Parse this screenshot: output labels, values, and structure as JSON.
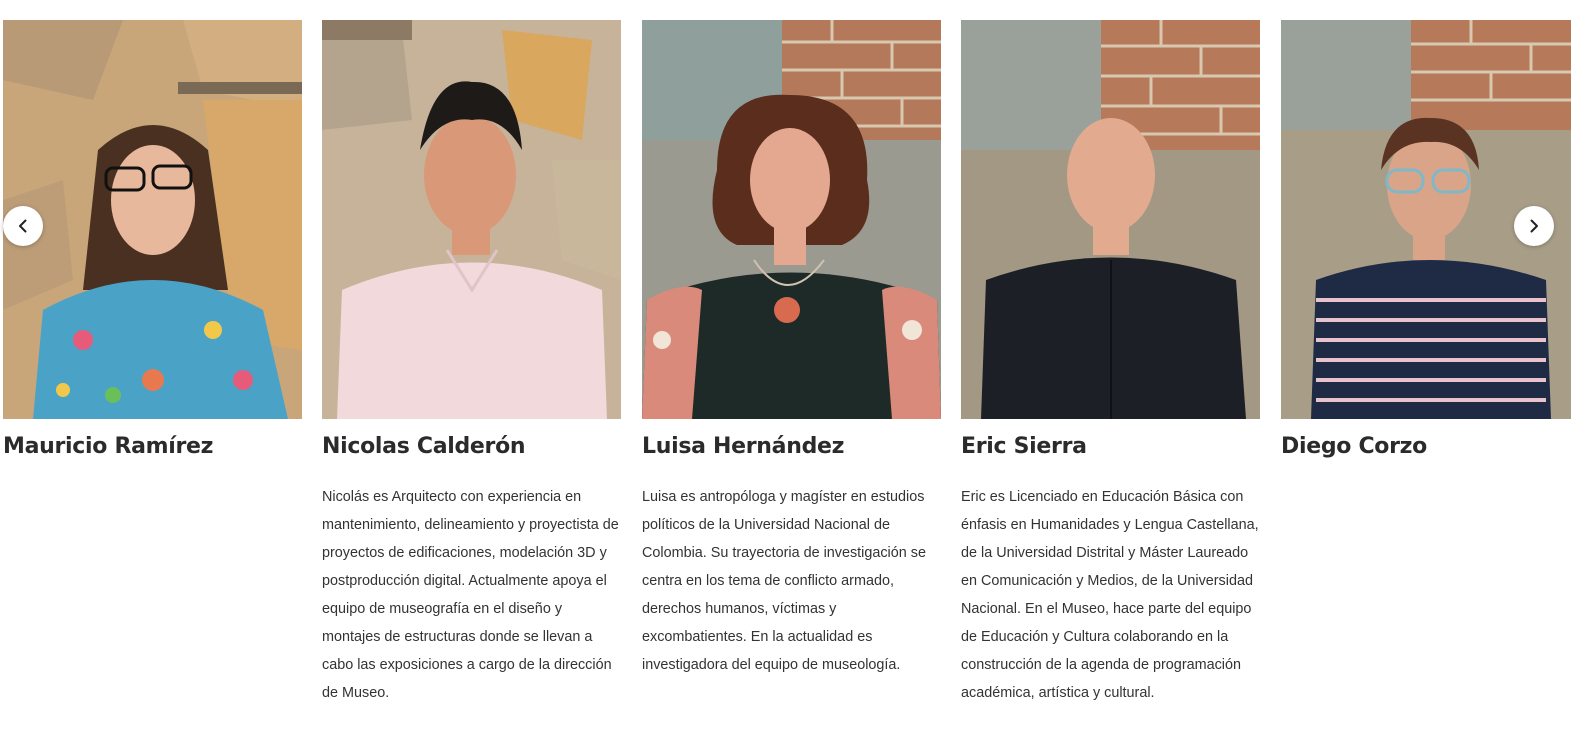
{
  "team": {
    "members": [
      {
        "name": "Mauricio Ramírez",
        "bio": "",
        "photo": {
          "bg": "#c9a57a",
          "shirt": "#4aa3c7",
          "skin": "#e8b89c",
          "hair": "#4a3020",
          "photo_label": "portrait-mauricio"
        }
      },
      {
        "name": "Nicolas Calderón",
        "bio": "Nicolás es Arquitecto con experiencia en mantenimiento, delineamiento y proyectista de proyectos de edificaciones, modelación 3D y postproducción digital. Actualmente apoya el equipo de museografía en el diseño y montajes de estructuras donde se llevan a cabo las exposiciones a cargo de la dirección de Museo.",
        "photo": {
          "bg": "#c7b39a",
          "shirt": "#f2d9dc",
          "skin": "#d99878",
          "hair": "#1e1a18",
          "photo_label": "portrait-nicolas"
        }
      },
      {
        "name": "Luisa Hernández",
        "bio": "Luisa es antropóloga y magíster en estudios políticos de la Universidad Nacional de Colombia. Su trayectoria de investigación se centra en los tema de conflicto armado, derechos humanos, víctimas y excombatientes. En la actualidad es investigadora del equipo de museología.",
        "photo": {
          "bg": "#9a9c96",
          "shirt": "#1e2a27",
          "skin": "#e3a88f",
          "hair": "#5a2d1c",
          "photo_label": "portrait-luisa"
        }
      },
      {
        "name": "Eric Sierra",
        "bio": "Eric es Licenciado en Educación Básica con énfasis en Humanidades y Lengua Castellana, de la Universidad Distrital y Máster Laureado en Comunicación y Medios, de la Universidad Nacional. En el Museo, hace parte del equipo de Educación y Cultura colaborando en la construcción de la agenda de programación académica, artística y cultural.",
        "photo": {
          "bg": "#a49c8c",
          "shirt": "#1c1f26",
          "skin": "#e2ab8f",
          "hair": "#c48a6c",
          "photo_label": "portrait-eric"
        }
      },
      {
        "name": "Diego Corzo",
        "bio": "",
        "photo": {
          "bg": "#b0a48e",
          "shirt": "#1f2a44",
          "skin": "#d9a488",
          "hair": "#5a3322",
          "photo_label": "portrait-diego"
        }
      }
    ]
  },
  "nav": {
    "prev_icon": "chevron-left-icon",
    "next_icon": "chevron-right-icon"
  }
}
